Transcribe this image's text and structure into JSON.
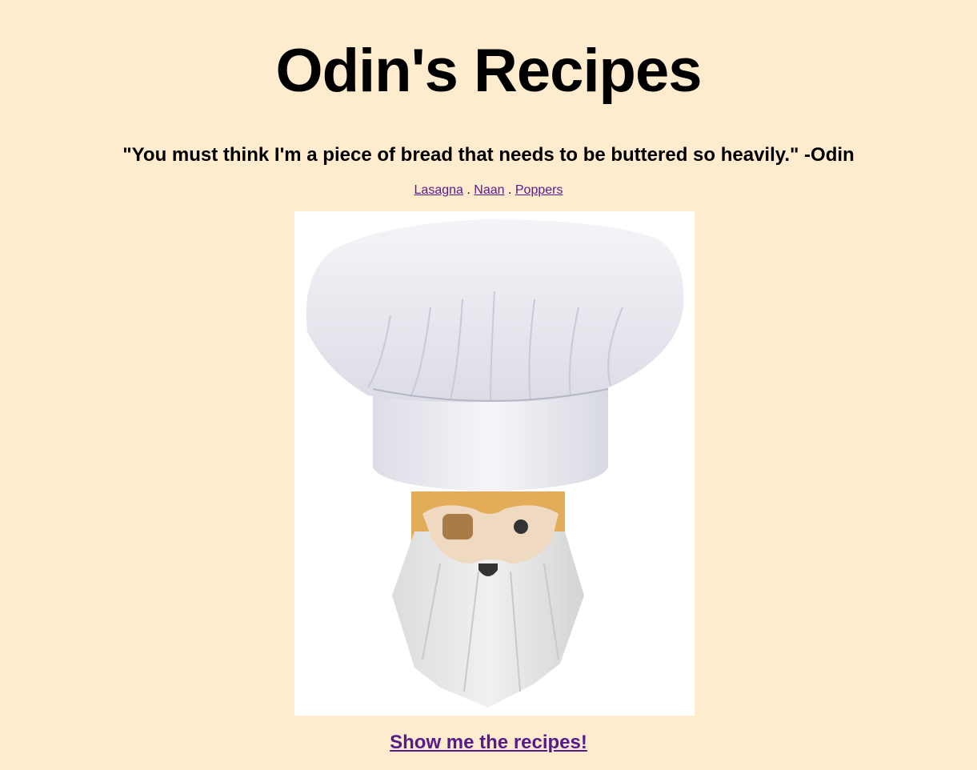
{
  "page": {
    "title": "Odin's Recipes",
    "quote": "\"You must think I'm a piece of bread that needs to be buttered so heavily.\" -Odin",
    "nav": {
      "items": [
        {
          "label": "Lasagna"
        },
        {
          "label": "Naan"
        },
        {
          "label": "Poppers"
        }
      ],
      "separator": "."
    },
    "image": {
      "alt": "Odin chef illustration",
      "icon": "chef-odin-illustration"
    },
    "cta_label": "Show me the recipes!"
  },
  "colors": {
    "background": "#ffebcd",
    "link": "#551a8b",
    "text": "#000000"
  }
}
